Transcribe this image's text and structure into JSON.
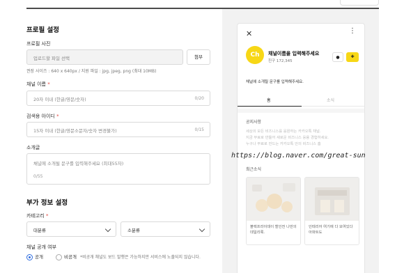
{
  "profile": {
    "section_title": "프로필 설정",
    "photo_label": "프로필 사진",
    "photo_placeholder": "업로드할 파일 선택",
    "attach_button": "첨부",
    "photo_hint": "권장 사이즈 : 640 x 640px / 지원 파일 : jpg, jpeg, png (최대 10MB)",
    "name_label": "채널 이름",
    "name_placeholder": "20자 이내 (한글/영문/숫자)",
    "name_count": "0/20",
    "search_id_label": "검색용 아이디",
    "search_id_placeholder": "15자 이내 (한글/영문소문자/숫자 변경불가)",
    "search_id_count": "0/15",
    "intro_label": "소개글",
    "intro_placeholder": "채널에 소개될 문구를 입력해주세요 (최대55자)",
    "intro_count": "0/55",
    "required_mark": "*"
  },
  "extra": {
    "section_title": "부가 정보 설정",
    "category_label": "카테고리",
    "category_major": "대분류",
    "category_minor": "소분류",
    "visibility_label": "채널 공개 여부",
    "visibility_public": "공개",
    "visibility_private": "비공개",
    "visibility_note": "*비공개 채널도 보드 발행은 가능하지만 서비스에 노출되지 않습니다."
  },
  "preview": {
    "close_icon": "close-icon",
    "more_icon": "more-vertical-icon",
    "logo_text": "Ch",
    "channel_name": "채널이름을 입력해주세요",
    "friends": "친구 172,345",
    "intro": "채널에 소개될 문구를 입력해주세요.",
    "tab_home": "홈",
    "tab_news": "소식",
    "notice_title": "공지사항",
    "notice_lines": [
      "세상의 모든 비즈니스를 응원하는 카카오톡 채널.",
      "지금 무료로 만들어 새로운 비즈니스 응용 경험하세요.",
      "누구나 무료로 만드는 카카오톡 안의 비즈니스 홈"
    ],
    "recent_title": "최근소식",
    "cards": [
      "블랙프라이데이 할인전 나만의 데일리룩.",
      "인테리어 여기에 다 모여있다 아파트도"
    ],
    "accent_color": "#f7d716"
  },
  "watermark": "https://blog.naver.com/great-sun"
}
